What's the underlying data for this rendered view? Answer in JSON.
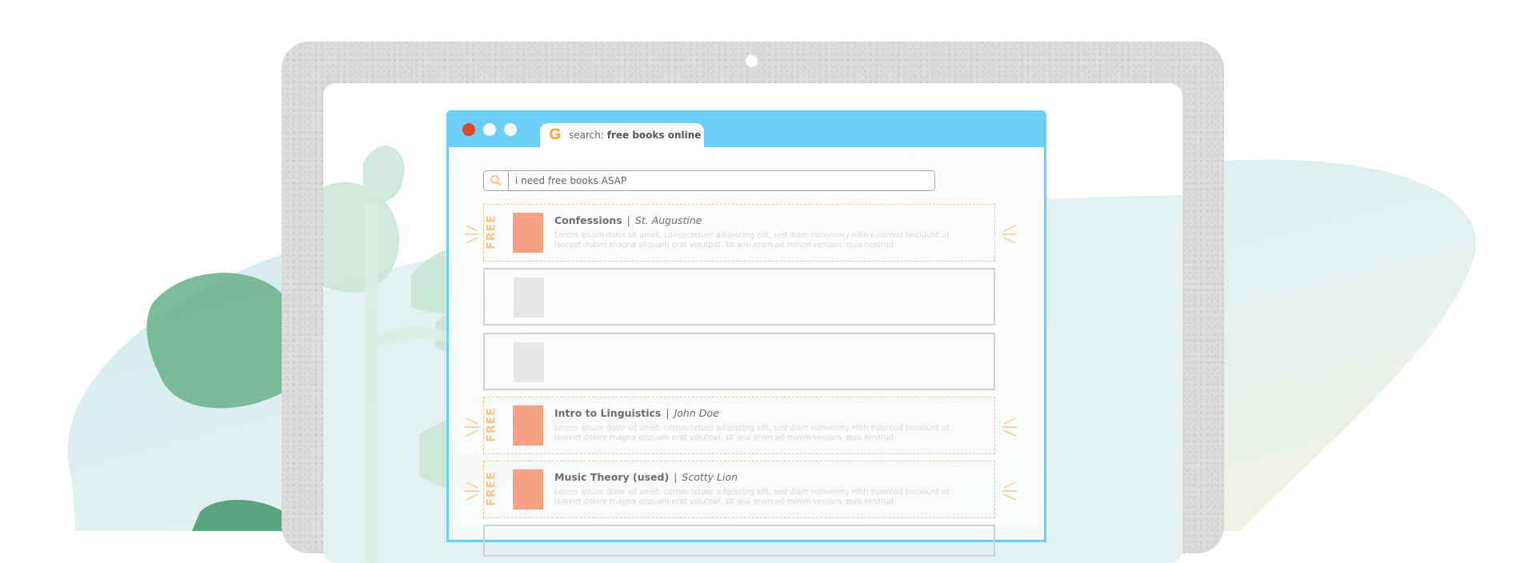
{
  "browser": {
    "tab": {
      "prefix": "search:",
      "query": "free books online"
    },
    "search": {
      "value": "i need free books ASAP",
      "placeholder": ""
    }
  },
  "results": [
    {
      "type": "free",
      "badge": "FREE",
      "title": "Confessions",
      "separator": "|",
      "author": "St. Augustine",
      "description": "Lorem ipsum dolor sit amet, consectetuer adipiscing elit, sed diam nonummy nibh euismod tincidunt ut laoreet dolore magna aliquam erat volutpat. Ut wisi enim ad minim veniam, quis nostrud"
    },
    {
      "type": "empty"
    },
    {
      "type": "empty"
    },
    {
      "type": "free",
      "badge": "FREE",
      "title": "Intro to Linguistics",
      "separator": "|",
      "author": "John Doe",
      "description": "Lorem ipsum dolor sit amet, consectetuer adipiscing elit, sed diam nonummy nibh euismod tincidunt ut laoreet dolore magna aliquam erat volutpat. Ut wisi enim ad minim veniam, quis nostrud"
    },
    {
      "type": "free",
      "badge": "FREE",
      "title": "Music Theory (used)",
      "separator": "|",
      "author": "Scotty Lion",
      "description": "Lorem ipsum dolor sit amet, consectetuer adipiscing elit, sed diam nonummy nibh euismod tincidunt ut laoreet dolore magna aliquam erat volutpat. Ut wisi enim ad minim veniam, quis nostrud"
    }
  ],
  "icons": {
    "tab": "g-logo-icon",
    "search": "search-icon",
    "thumbnail": "book-cover-icon"
  },
  "colors": {
    "accent": "#6ccff5",
    "free": "#f8c88a",
    "cover": "#f4a185",
    "close": "#e2462a"
  }
}
